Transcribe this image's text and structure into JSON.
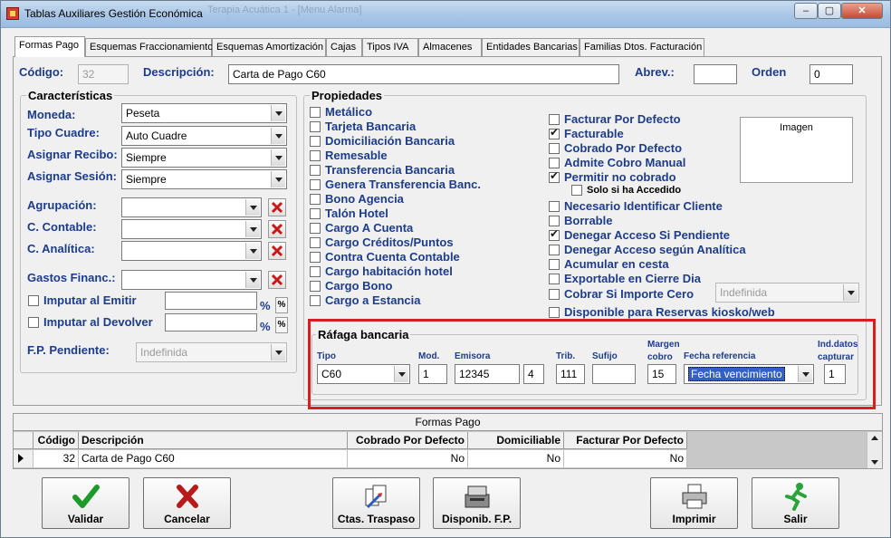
{
  "window": {
    "title": "Tablas Auxiliares Gestión Económica",
    "ghost_title": "Terapia Acuática 1 - [Menu Alarma]",
    "btn_min": "–",
    "btn_max": "▢",
    "btn_close": "✕"
  },
  "tabs": [
    {
      "label": "Formas Pago"
    },
    {
      "label": "Esquemas Fraccionamiento"
    },
    {
      "label": "Esquemas Amortización"
    },
    {
      "label": "Cajas"
    },
    {
      "label": "Tipos IVA"
    },
    {
      "label": "Almacenes"
    },
    {
      "label": "Entidades Bancarias"
    },
    {
      "label": "Familias Dtos. Facturación"
    }
  ],
  "header": {
    "codigo_label": "Código:",
    "codigo_value": "32",
    "descripcion_label": "Descripción:",
    "descripcion_value": "Carta de Pago C60",
    "abrev_label": "Abrev.:",
    "abrev_value": "",
    "orden_label": "Orden",
    "orden_value": "0"
  },
  "caracteristicas": {
    "title": "Características",
    "moneda_label": "Moneda:",
    "moneda_value": "Peseta",
    "tipo_cuadre_label": "Tipo Cuadre:",
    "tipo_cuadre_value": "Auto Cuadre",
    "asignar_recibo_label": "Asignar Recibo:",
    "asignar_recibo_value": "Siempre",
    "asignar_sesion_label": "Asignar Sesión:",
    "asignar_sesion_value": "Siempre",
    "agrupacion_label": "Agrupación:",
    "c_contable_label": "C. Contable:",
    "c_analitica_label": "C. Analítica:",
    "gastos_financ_label": "Gastos Financ.:",
    "imputar_emitir_label": "Imputar al Emitir",
    "imputar_devolver_label": "Imputar al Devolver",
    "pct_symbol": "%",
    "pct_button": "%",
    "fp_pendiente_label": "F.P. Pendiente:",
    "fp_pendiente_value": "Indefinida"
  },
  "propiedades": {
    "title": "Propiedades",
    "left_checks": [
      {
        "label": "Metálico",
        "checked": false
      },
      {
        "label": "Tarjeta Bancaria",
        "checked": false
      },
      {
        "label": "Domiciliación Bancaria",
        "checked": false
      },
      {
        "label": "Remesable",
        "checked": false
      },
      {
        "label": "Transferencia Bancaria",
        "checked": false
      },
      {
        "label": "Genera Transferencia Banc.",
        "checked": false
      },
      {
        "label": "Bono Agencia",
        "checked": false
      },
      {
        "label": "Talón Hotel",
        "checked": false
      },
      {
        "label": "Cargo A Cuenta",
        "checked": false
      },
      {
        "label": "Cargo Créditos/Puntos",
        "checked": false
      },
      {
        "label": "Contra Cuenta Contable",
        "checked": false
      },
      {
        "label": "Cargo habitación hotel",
        "checked": false
      },
      {
        "label": "Cargo Bono",
        "checked": false
      },
      {
        "label": "Cargo a Estancia",
        "checked": false
      }
    ],
    "right_checks": [
      {
        "label": "Facturar Por Defecto",
        "checked": false
      },
      {
        "label": "Facturable",
        "checked": true
      },
      {
        "label": "Cobrado Por Defecto",
        "checked": false
      },
      {
        "label": "Admite Cobro Manual",
        "checked": false
      },
      {
        "label": "Permitir no cobrado",
        "checked": true
      },
      {
        "label": "Necesario Identificar Cliente",
        "checked": false
      },
      {
        "label": "Borrable",
        "checked": false
      },
      {
        "label": "Denegar Acceso Si Pendiente",
        "checked": true
      },
      {
        "label": "Denegar Acceso según Analítica",
        "checked": false
      },
      {
        "label": "Acumular en cesta",
        "checked": false
      },
      {
        "label": "Exportable en Cierre Dia",
        "checked": false
      },
      {
        "label": "Cobrar Si Importe Cero",
        "checked": false
      },
      {
        "label": "Disponible para Reservas kiosko/web",
        "checked": false
      }
    ],
    "solo_si_accedido": "Solo si ha Accedido",
    "cobrar_cero_combo": "Indefinida",
    "imagen_label": "Imagen"
  },
  "rafaga": {
    "title": "Ráfaga bancaria",
    "tipo_label": "Tipo",
    "tipo_value": "C60",
    "mod_label": "Mod.",
    "mod_value": "1",
    "emisora_label": "Emisora",
    "emisora_value": "12345",
    "emisora_suffix": "4",
    "trib_label": "Trib.",
    "trib_value": "111",
    "sufijo_label": "Sufijo",
    "sufijo_value": "",
    "margen_label1": "Margen",
    "margen_label2": "cobro",
    "margen_value": "15",
    "fecha_ref_label": "Fecha referencia",
    "fecha_ref_value": "Fecha vencimiento",
    "ind_label1": "Ind.datos",
    "ind_label2": "capturar",
    "ind_value": "1"
  },
  "grid": {
    "title": "Formas Pago",
    "columns": [
      "Código",
      "Descripción",
      "Cobrado Por Defecto",
      "Domiciliable",
      "Facturar Por Defecto"
    ],
    "rows": [
      {
        "codigo": "32",
        "descripcion": "Carta de Pago C60",
        "cobrado": "No",
        "domiciliable": "No",
        "facturar": "No"
      }
    ]
  },
  "buttons": {
    "validar": "Validar",
    "cancelar": "Cancelar",
    "ctas_traspaso": "Ctas. Traspaso",
    "disponib_fp": "Disponib. F.P.",
    "imprimir": "Imprimir",
    "salir": "Salir"
  },
  "colors": {
    "label_blue": "#1c3c8c",
    "highlight_red": "#d81f1f",
    "selection_blue": "#3060c8"
  }
}
